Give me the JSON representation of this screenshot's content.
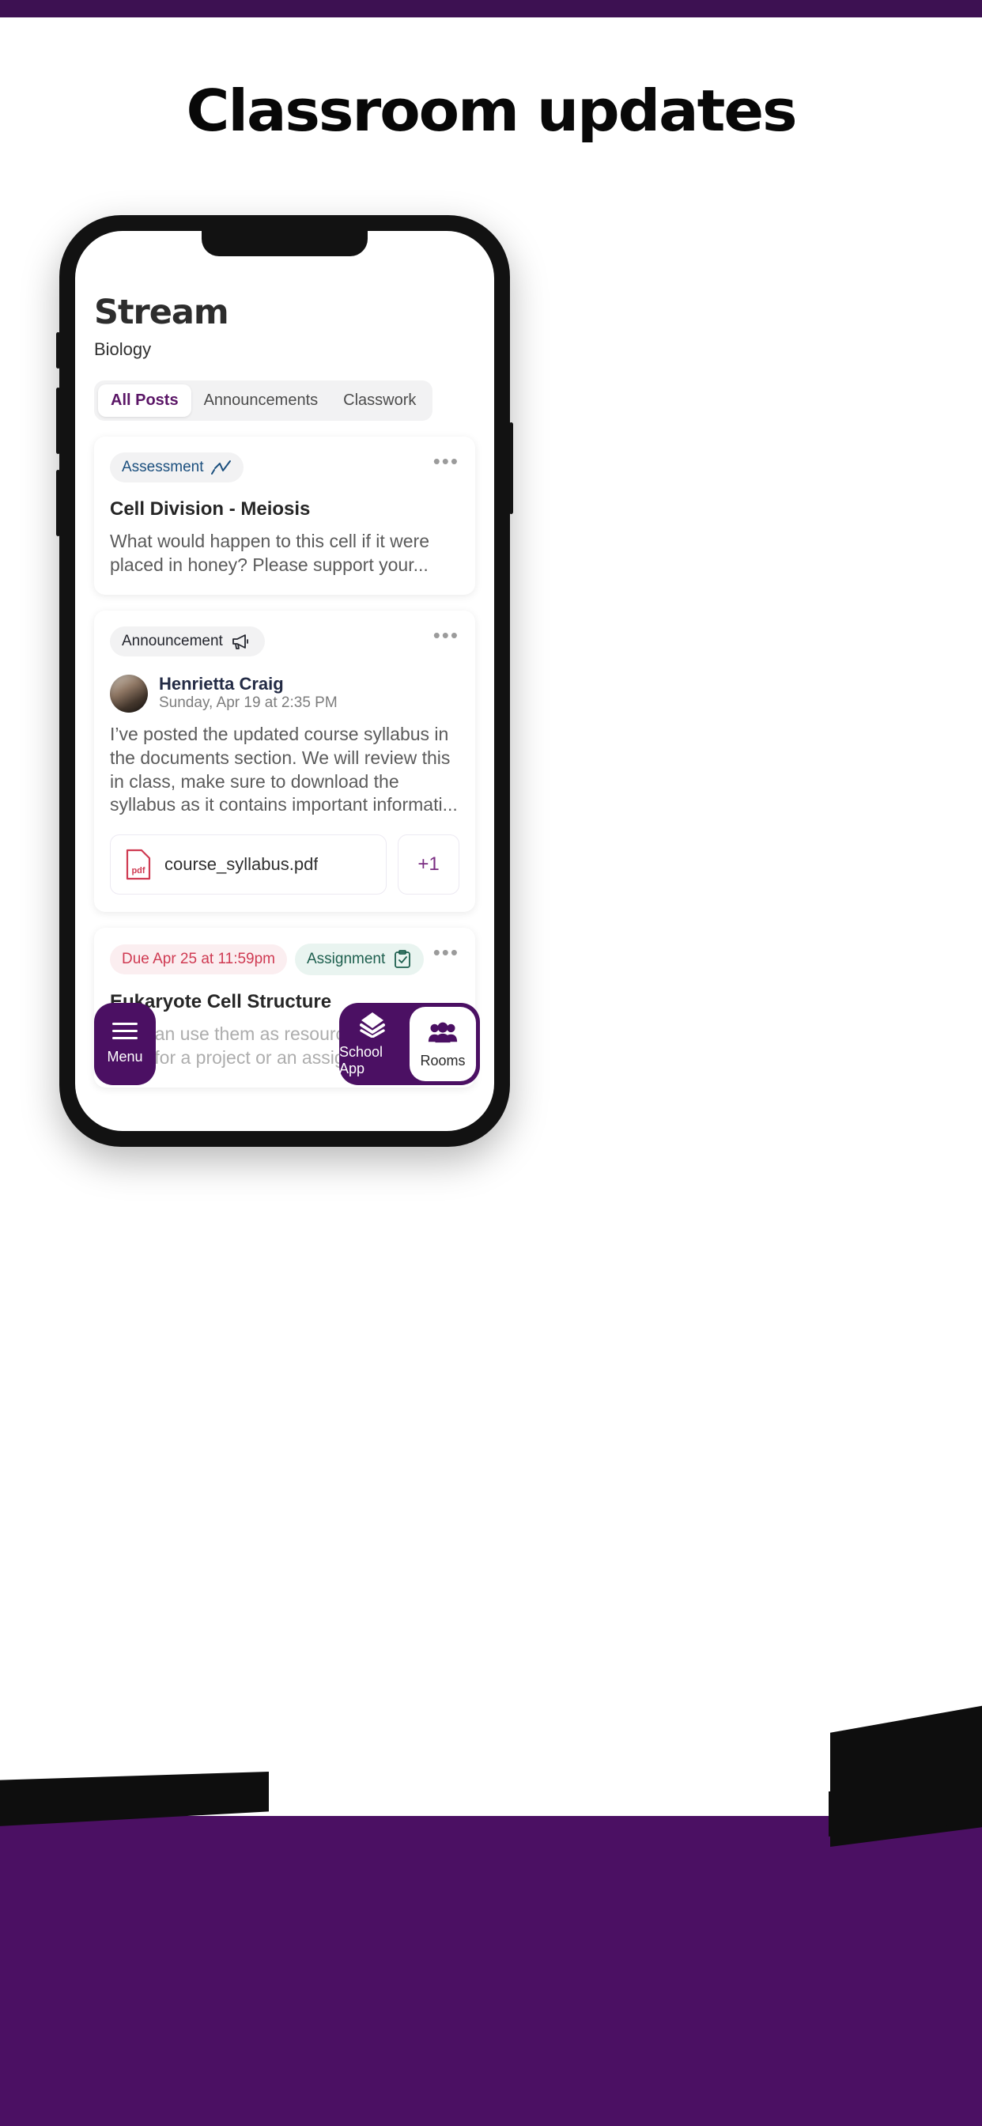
{
  "hero": {
    "title": "Classroom updates",
    "accent_purple": "#4b1063",
    "top_bar_color": "#3d1152"
  },
  "screen": {
    "title": "Stream",
    "subtitle": "Biology",
    "tabs": [
      {
        "label": "All Posts",
        "active": true
      },
      {
        "label": "Announcements",
        "active": false
      },
      {
        "label": "Classwork",
        "active": false
      }
    ],
    "posts": [
      {
        "badge": {
          "label": "Assessment",
          "icon": "trend-chart-icon",
          "color": "#1b4f7e"
        },
        "menu": "•••",
        "title": "Cell Division - Meiosis",
        "body": "What would happen to this cell if it were placed in honey? Please support your..."
      },
      {
        "badge": {
          "label": "Announcement",
          "icon": "megaphone-icon",
          "color": "#24262e"
        },
        "menu": "•••",
        "author": {
          "name": "Henrietta Craig",
          "timestamp": "Sunday, Apr 19 at 2:35 PM"
        },
        "body": "I’ve posted the updated course syllabus in the documents section. We will review this in class, make sure to download the syllabus as it contains important informati...",
        "attachments": [
          {
            "name": "course_syllabus.pdf",
            "type": "pdf",
            "icon_label": "pdf",
            "color": "#cf3a52"
          }
        ],
        "more_attachments": "+1"
      },
      {
        "due_badge": {
          "label": "Due Apr 25 at 11:59pm",
          "color": "#cf3a52"
        },
        "badge": {
          "label": "Assignment",
          "icon": "clipboard-check-icon",
          "color": "#1d5f4e"
        },
        "menu": "•••",
        "title": "Eukaryote Cell Structure",
        "body": "You can use them as resources to go to for help, for a project or an assignment. The"
      }
    ],
    "bottom_nav": {
      "menu": {
        "label": "Menu",
        "icon": "hamburger-icon"
      },
      "items": [
        {
          "label": "School App",
          "icon": "layers-icon",
          "active": false
        },
        {
          "label": "Rooms",
          "icon": "people-group-icon",
          "active": true
        }
      ]
    }
  }
}
